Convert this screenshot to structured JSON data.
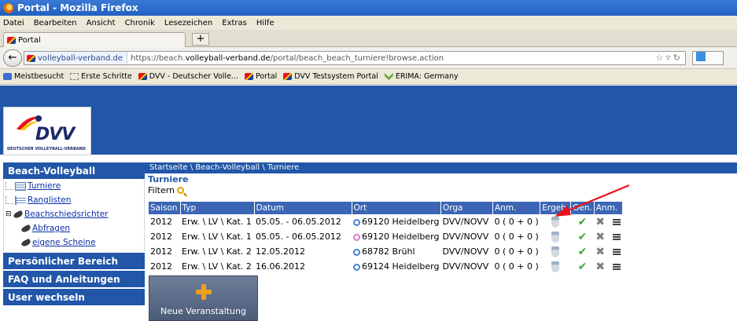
{
  "window": {
    "title": "Portal - Mozilla Firefox"
  },
  "menu": [
    "Datei",
    "Bearbeiten",
    "Ansicht",
    "Chronik",
    "Lesezeichen",
    "Extras",
    "Hilfe"
  ],
  "tab": {
    "label": "Portal",
    "new_tab": "+"
  },
  "address": {
    "site": "volleyball-verband.de",
    "url_prefix": "https://beach.",
    "url_domain": "volleyball-verband.de",
    "url_path": "/portal/beach_beach_turniere!browse.action"
  },
  "bookmarks": [
    "Meistbesucht",
    "Erste Schritte",
    "DVV - Deutscher Volle...",
    "Portal",
    "DVV Testsystem Portal",
    "ERIMA: Germany"
  ],
  "logo": {
    "text": "DVV",
    "subtitle": "DEUTSCHER VOLLEYBALL-VERBAND"
  },
  "sidebar": {
    "section_title": "Beach-Volleyball",
    "items": [
      "Turniere",
      "Ranglisten",
      "Beachschiedsrichter",
      "Abfragen",
      "eigene Scheine"
    ],
    "sections": [
      "Persönlicher Bereich",
      "FAQ und Anleitungen",
      "User wechseln"
    ]
  },
  "main": {
    "breadcrumb": "Startseite \\ Beach-Volleyball \\ Turniere",
    "title": "Turniere",
    "filter": "Filtern",
    "columns": [
      "Saison",
      "Typ",
      "Datum",
      "Ort",
      "Orga",
      "Anm.",
      "Ergeb.",
      "Gen.",
      "Anm."
    ],
    "rows": [
      {
        "saison": "2012",
        "typ": "Erw. \\ LV \\ Kat. 1",
        "datum": "05.05. - 06.05.2012",
        "gender": "m",
        "ort": "69120 Heidelberg",
        "orga": "DVV/NOVV",
        "anm": "0 ( 0 + 0 )"
      },
      {
        "saison": "2012",
        "typ": "Erw. \\ LV \\ Kat. 1",
        "datum": "05.05. - 06.05.2012",
        "gender": "f",
        "ort": "69120 Heidelberg",
        "orga": "DVV/NOVV",
        "anm": "0 ( 0 + 0 )"
      },
      {
        "saison": "2012",
        "typ": "Erw. \\ LV \\ Kat. 2",
        "datum": "12.05.2012",
        "gender": "m",
        "ort": "68782 Brühl",
        "orga": "DVV/NOVV",
        "anm": "0 ( 0 + 0 )"
      },
      {
        "saison": "2012",
        "typ": "Erw. \\ LV \\ Kat. 2",
        "datum": "16.06.2012",
        "gender": "m",
        "ort": "69124 Heidelberg",
        "orga": "DVV/NOVV",
        "anm": "0 ( 0 + 0 )"
      }
    ],
    "new_button": "Neue Veranstaltung"
  },
  "colors": {
    "brand_blue": "#2156a8",
    "table_header": "#3c66b5",
    "arrow": "#e8131a"
  }
}
